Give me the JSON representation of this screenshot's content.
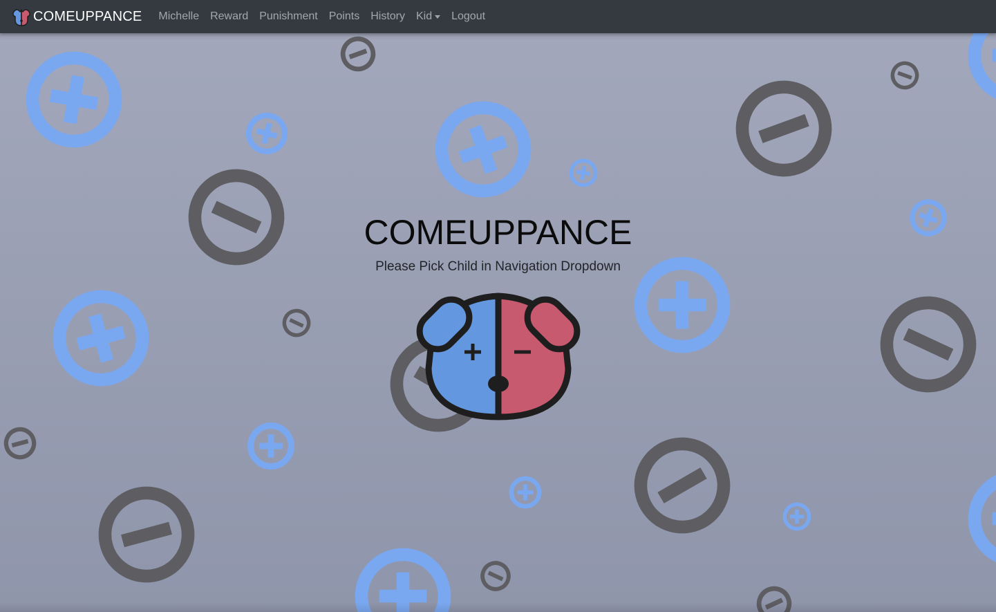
{
  "navbar": {
    "brand": "COMEUPPANCE",
    "links": [
      "Michelle",
      "Reward",
      "Punishment",
      "Points",
      "History",
      "Kid",
      "Logout"
    ]
  },
  "hero": {
    "title": "COMEUPPANCE",
    "subtitle": "Please Pick Child in Navigation Dropdown"
  },
  "colors": {
    "navbar_bg": "#343a40",
    "plus_circle": "#7aa8f0",
    "minus_circle": "#5d5d62",
    "mascot_blue": "#6398e0",
    "mascot_red": "#c85a6f"
  },
  "icons": {
    "brand_logo": "dog-logo-icon",
    "dropdown": "caret-down-icon",
    "background": [
      "plus-circle-icon",
      "minus-circle-icon"
    ],
    "mascot": "dog-mascot-icon"
  }
}
